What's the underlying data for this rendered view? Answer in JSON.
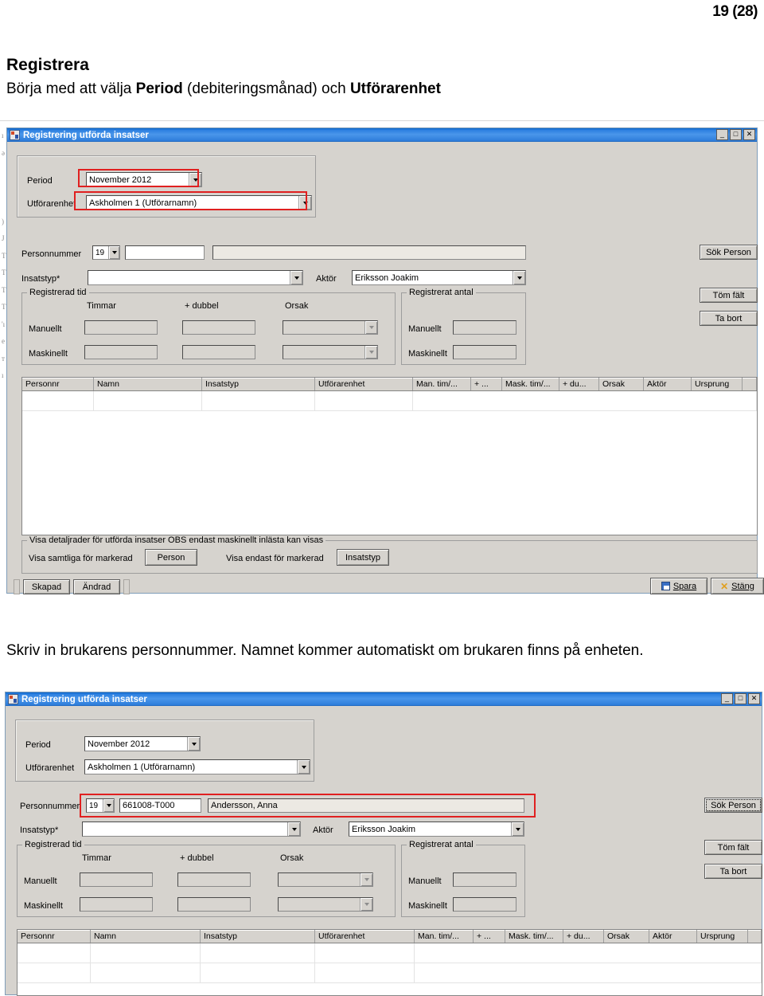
{
  "document": {
    "page_number": "19 (28)",
    "heading": "Registrera",
    "intro_pre": "Börja med att välja ",
    "intro_b1": "Period",
    "intro_mid": " (debiteringsmånad) och ",
    "intro_b2": "Utförarenhet",
    "middle_text": "Skriv in brukarens personnummer. Namnet kommer automatiskt om brukaren finns på enheten.",
    "margin_bleed": "ı\nə\n\n\n\n)\nJ\nT\nT\nT\nT\n'ı\ne\nт\nı"
  },
  "window": {
    "title": "Registrering utförda insatser",
    "icon": "app-icon",
    "controls": {
      "minimize": "_",
      "maximize": "□",
      "close": "✕"
    }
  },
  "top_panel": {
    "period_label": "Period",
    "period_value": "November 2012",
    "unit_label": "Utförarenhet",
    "unit_value": "Askholmen 1 (Utförarnamn)"
  },
  "person_row": {
    "label": "Personnummer",
    "century_value": "19",
    "pnr_value_empty": "",
    "pnr_value_filled": "661008-T000",
    "name_value_empty": "",
    "name_value_filled": "Andersson, Anna"
  },
  "insats_row": {
    "label": "Insatstyp*",
    "value": "",
    "aktor_label": "Aktör",
    "aktor_value": "Eriksson Joakim"
  },
  "registrerad_tid": {
    "legend": "Registrerad tid",
    "col_timmar": "Timmar",
    "col_dubbel": "+ dubbel",
    "col_orsak": "Orsak",
    "row_manuellt": "Manuellt",
    "row_maskinellt": "Maskinellt",
    "manuellt_timmar": "",
    "manuellt_dubbel": "",
    "manuellt_orsak": "",
    "maskinellt_timmar": "",
    "maskinellt_dubbel": "",
    "maskinellt_orsak": ""
  },
  "registrerat_antal": {
    "legend": "Registrerat antal",
    "row_manuellt": "Manuellt",
    "row_maskinellt": "Maskinellt",
    "manuellt_value": "",
    "maskinellt_value": ""
  },
  "side_buttons": {
    "sok_person": "Sök Person",
    "tom_falt": "Töm fält",
    "ta_bort": "Ta bort"
  },
  "grid": {
    "columns": [
      "Personnr",
      "Namn",
      "Insatstyp",
      "Utförarenhet",
      "Man. tim/...",
      "+ ...",
      "Mask. tim/...",
      "+ du...",
      "Orsak",
      "Aktör",
      "Ursprung",
      ""
    ],
    "rows": []
  },
  "detail_group": {
    "legend": "Visa detaljrader för utförda insatser OBS endast maskinellt inlästa kan visas",
    "left_label": "Visa samtliga för markerad",
    "left_button": "Person",
    "right_label": "Visa endast för markerad",
    "right_button": "Insatstyp"
  },
  "status_bar": {
    "skapad": "Skapad",
    "andrad": "Ändrad"
  },
  "footer_buttons": {
    "spara": "Spara",
    "spara_icon": "save-icon",
    "stang": "Stäng",
    "stang_icon": "close-x-icon"
  },
  "colors": {
    "highlight": "#e02020",
    "titlebar": "#2b7fe0",
    "face": "#d6d3ce"
  }
}
